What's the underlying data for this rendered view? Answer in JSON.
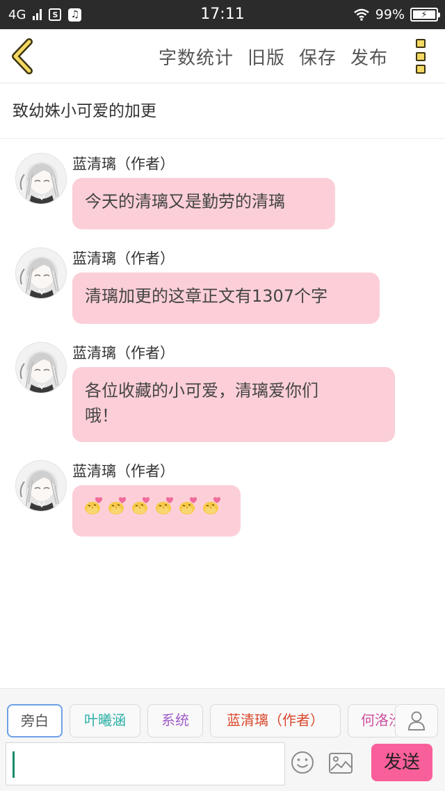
{
  "status_bar": {
    "network": "4G",
    "sim_icon_letter": "S",
    "music_icon": "music-note",
    "time": "17:11",
    "battery": "99%",
    "battery_level_percent": 99
  },
  "header": {
    "back_icon": "chevron-left",
    "actions": [
      "字数统计",
      "旧版",
      "保存",
      "发布"
    ],
    "more_icon": "more-vertical"
  },
  "chapter_title": "致幼姝小可爱的加更",
  "messages": [
    {
      "author": "蓝清璃（作者）",
      "text": "今天的清璃又是勤劳的清璃"
    },
    {
      "author": "蓝清璃（作者）",
      "text": "清璃加更的这章正文有1307个字"
    },
    {
      "author": "蓝清璃（作者）",
      "text_line1": "各位收藏的小可爱，清璃爱你们",
      "text_line2": "哦！"
    },
    {
      "author": "蓝清璃（作者）",
      "emoji_icon": "chick-heart-emoji",
      "emoji_count": 6
    }
  ],
  "role_tabs": [
    {
      "label": "旁白",
      "color": "#555555"
    },
    {
      "label": "叶曦涵",
      "color": "#2bb0a7"
    },
    {
      "label": "系统",
      "color": "#a05cc8"
    },
    {
      "label": "蓝清璃（作者）",
      "color": "#d9472b"
    },
    {
      "label": "何洛汐",
      "color": "#cc4fa1"
    }
  ],
  "input": {
    "value": "",
    "placeholder": ""
  },
  "send_label": "发送",
  "colors": {
    "bubble": "#fccfd8",
    "send_button": "#f95f9b",
    "active_tab_border": "#6ea0e6"
  }
}
